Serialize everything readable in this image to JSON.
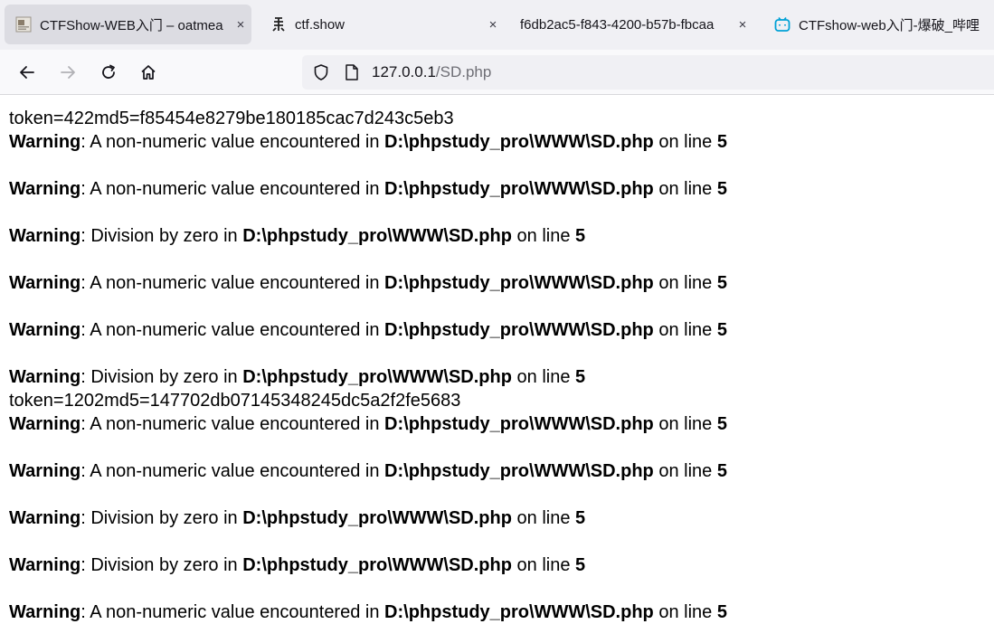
{
  "tabs": [
    {
      "title": "CTFShow-WEB入门 – oatmea",
      "favicon": "document-thumbnail-icon",
      "active": true
    },
    {
      "title": "ctf.show",
      "favicon": "ctfshow-logo-icon",
      "active": false
    },
    {
      "title": "f6db2ac5-f843-4200-b57b-fbcaa",
      "favicon": "",
      "active": false
    },
    {
      "title": "CTFshow-web入门-爆破_哔哩",
      "favicon": "bilibili-icon",
      "active": false
    }
  ],
  "tab_close_glyph": "×",
  "address": {
    "host": "127.0.0.1",
    "path": "/SD.php"
  },
  "output": {
    "label_warning": "Warning",
    "text_nonnumeric": ": A non-numeric value encountered in ",
    "text_divzero": ": Division by zero in ",
    "file": "D:\\phpstudy_pro\\WWW\\SD.php",
    "on_line": " on line ",
    "line_no": "5",
    "token1": "token=422md5=f85454e8279be180185cac7d243c5eb3",
    "token2": "token=1202md5=147702db07145348245dc5a2f2fe5683"
  },
  "colors": {
    "accent": "#0060df",
    "tab_strip": "#f0f0f4",
    "active_tab": "#dcdce2"
  }
}
